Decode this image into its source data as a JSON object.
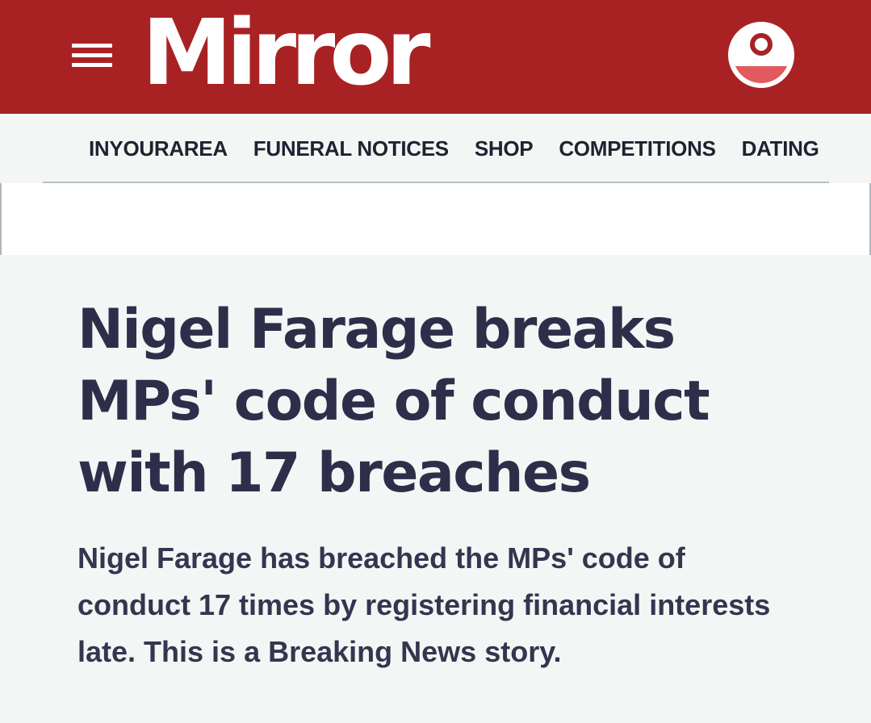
{
  "header": {
    "logo_text": "Mirror",
    "menu_icon": "hamburger-menu-icon",
    "account_icon": "user-account-icon",
    "background_color": "#a82224"
  },
  "subnav": {
    "items": [
      {
        "label": "INYOURAREA"
      },
      {
        "label": "FUNERAL NOTICES"
      },
      {
        "label": "SHOP"
      },
      {
        "label": "COMPETITIONS"
      },
      {
        "label": "DATING"
      }
    ]
  },
  "article": {
    "headline": "Nigel Farage breaks MPs' code of conduct with 17 breaches",
    "standfirst": "Nigel Farage has breached the MPs' code of conduct 17 times by registering financial interests late. This is a Breaking News story.",
    "text_color": "#2d2f4a"
  }
}
